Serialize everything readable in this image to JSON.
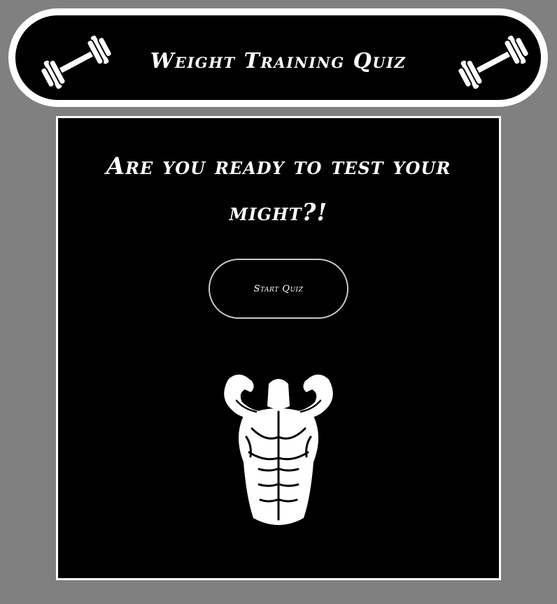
{
  "header": {
    "title": "Weight Training Quiz",
    "left_icon": "dumbbell-icon",
    "right_icon": "dumbbell-icon"
  },
  "main": {
    "headline_line1": "Are you ready to test your",
    "headline_line2": "might?!",
    "start_button_label": "Start Quiz",
    "illustration": "bodybuilder-icon"
  },
  "colors": {
    "page_background": "#808080",
    "panel_background": "#000000",
    "text": "#ffffff",
    "border": "#ffffff"
  }
}
